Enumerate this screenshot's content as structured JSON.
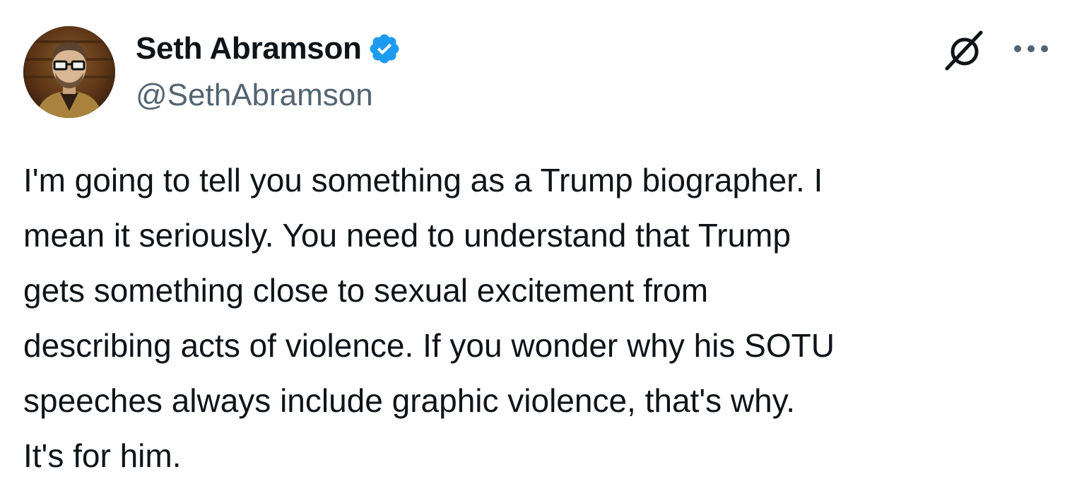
{
  "author": {
    "display_name": "Seth Abramson",
    "handle": "@SethAbramson",
    "verified_badge_icon": "verified-badge-icon",
    "avatar_icon": "avatar-photo"
  },
  "actions": {
    "grok_icon": "grok-icon",
    "more_icon": "more-options-icon"
  },
  "tweet": {
    "text": "I'm going to tell you something as a Trump biographer. I\nmean it seriously. You need to understand that Trump\ngets something close to sexual excitement from\ndescribing acts of violence. If you wonder why his SOTU\nspeeches always include graphic violence, that's why.\nIt's for him."
  },
  "colors": {
    "text_primary": "#0f1419",
    "text_secondary": "#536471",
    "verified_blue": "#1d9bf0",
    "background": "#ffffff"
  }
}
